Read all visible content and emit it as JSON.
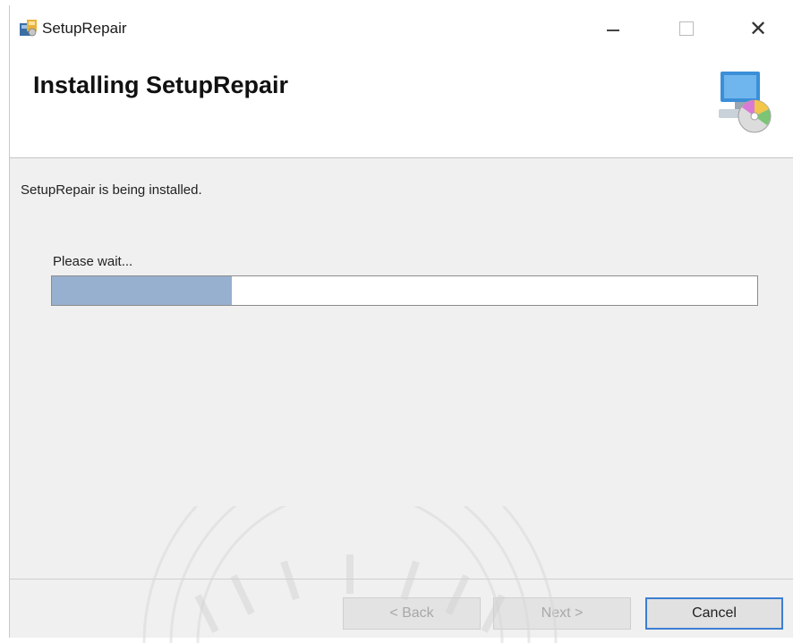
{
  "window": {
    "title": "SetupRepair",
    "controls": {
      "minimize_icon": "minimize-icon",
      "maximize_icon": "maximize-icon",
      "close_label": "✕"
    }
  },
  "header": {
    "title": "Installing SetupRepair",
    "icon": "computer-disc-icon"
  },
  "body": {
    "status_text": "SetupRepair is being installed.",
    "wait_text": "Please wait...",
    "progress": {
      "fraction": 0.255,
      "fill_color": "#97b0cf"
    }
  },
  "buttons": {
    "back_label": "< Back",
    "next_label": "Next >",
    "cancel_label": "Cancel"
  },
  "colors": {
    "accent": "#3c7fd2",
    "window_bg": "#f0f0f0"
  }
}
